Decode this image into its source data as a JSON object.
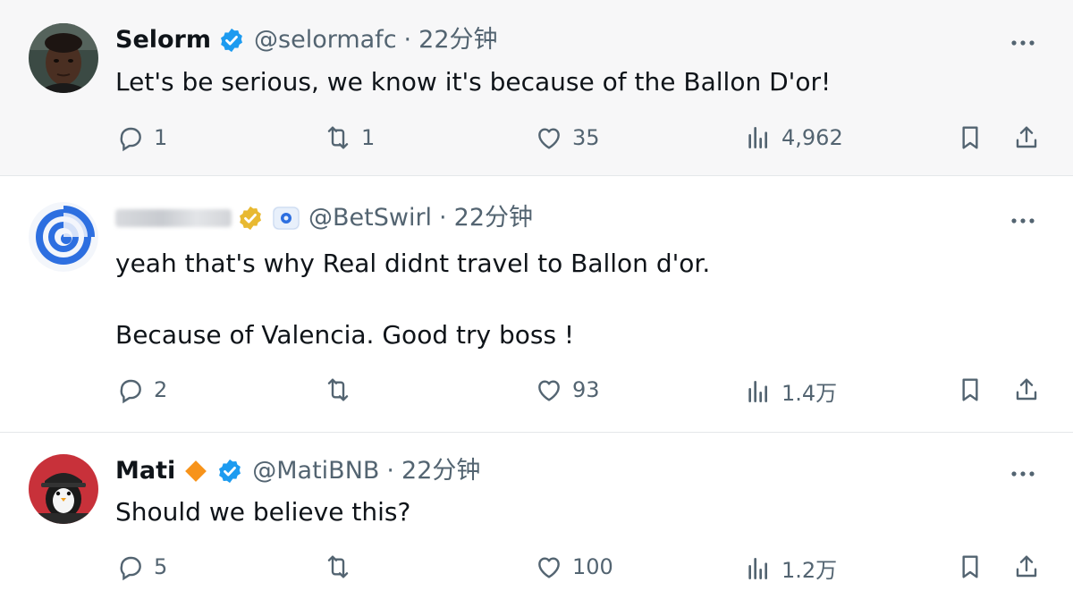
{
  "tweets": [
    {
      "name": "Selorm",
      "handle": "@selormafc",
      "time": "22分钟",
      "text": "Let's be serious, we know it's because of the Ballon D'or!",
      "replies": "1",
      "reposts": "1",
      "likes": "35",
      "views": "4,962"
    },
    {
      "name": "",
      "handle": "@BetSwirl",
      "time": "22分钟",
      "text": "yeah that's why Real didnt travel to Ballon d'or.\n\nBecause of Valencia. Good try boss !",
      "replies": "2",
      "reposts": "",
      "likes": "93",
      "views": "1.4万"
    },
    {
      "name": "Mati",
      "handle": "@MatiBNB",
      "time": "22分钟",
      "text": "Should we believe this?",
      "replies": "5",
      "reposts": "",
      "likes": "100",
      "views": "1.2万"
    }
  ],
  "colors": {
    "verified": "#1d9bf0",
    "gold": "#e8b931",
    "orange": "#f7931a",
    "muted": "#536471",
    "text": "#0f1419"
  },
  "icons": [
    "verified-badge-icon",
    "reply-icon",
    "repost-icon",
    "like-icon",
    "views-icon",
    "bookmark-icon",
    "share-icon",
    "more-icon"
  ]
}
